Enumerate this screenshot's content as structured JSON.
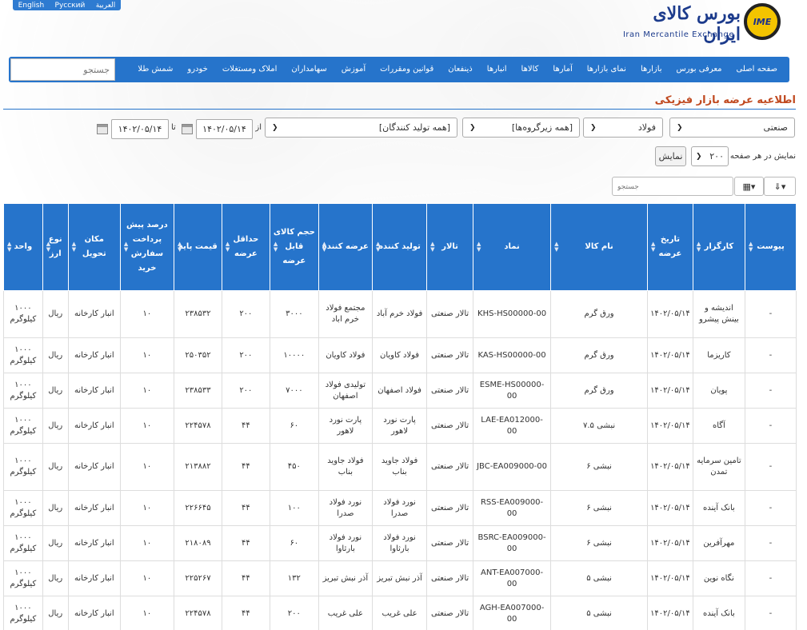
{
  "lang": [
    "العربية",
    "Русский",
    "English"
  ],
  "logo": {
    "mark": "IME",
    "fa": "بورس کالای ایران",
    "en": "Iran Mercantile Exchange"
  },
  "nav": [
    "صفحه اصلی",
    "معرفی بورس",
    "بازارها",
    "نمای بازارها",
    "آمارها",
    "کالاها",
    "انبارها",
    "ذینفعان",
    "قوانین ومقررات",
    "آموزش",
    "سهامداران",
    "املاک ومستغلات",
    "خودرو",
    "شمش طلا"
  ],
  "nav_search_placeholder": "جستجو",
  "page_title": "اطلاعیه عرضه بازار فیزیکی",
  "filters": {
    "market": "صنعتی",
    "group": "فولاد",
    "subgroup": "[همه زیرگروه‌ها]",
    "producer": "[همه تولید کنندگان]",
    "from_label": "از",
    "from_date": "۱۴۰۲/۰۵/۱۴",
    "to_label": "تا",
    "to_date": "۱۴۰۲/۰۵/۱۴",
    "per_page_label": "نمایش در هر صفحه",
    "per_page": "۲۰۰",
    "show_button": "نمایش"
  },
  "table_search_placeholder": "جستجو",
  "headers": [
    "پیوست",
    "کارگزار",
    "تاریخ عرضه",
    "نام کالا",
    "نماد",
    "تالار",
    "تولید کننده",
    "عرضه کننده",
    "حجم کالای قابل عرضه",
    "حداقل عرضه",
    "قیمت پایه",
    "درصد پیش پرداخت سفارش خرید",
    "مکان تحویل",
    "نوع ارز",
    "واحد"
  ],
  "rows": [
    [
      "-",
      "اندیشه و بینش پیشرو",
      "۱۴۰۲/۰۵/۱۴",
      "ورق گرم",
      "KHS-HS00000-00",
      "تالار صنعتی",
      "فولاد خرم آباد",
      "مجتمع فولاد خرم اباد",
      "۳۰۰۰",
      "۲۰۰",
      "۲۳۸۵۳۲",
      "۱۰",
      "انبار کارخانه",
      "ریال",
      "۱۰۰۰ کیلوگرم"
    ],
    [
      "-",
      "کاریزما",
      "۱۴۰۲/۰۵/۱۴",
      "ورق گرم",
      "KAS-HS00000-00",
      "تالار صنعتی",
      "فولاد کاویان",
      "فولاد کاویان",
      "۱۰۰۰۰",
      "۲۰۰",
      "۲۵۰۳۵۲",
      "۱۰",
      "انبار کارخانه",
      "ریال",
      "۱۰۰۰ کیلوگرم"
    ],
    [
      "-",
      "پویان",
      "۱۴۰۲/۰۵/۱۴",
      "ورق گرم",
      "ESME-HS00000-00",
      "تالار صنعتی",
      "فولاد اصفهان",
      "تولیدی فولاد اصفهان",
      "۷۰۰۰",
      "۲۰۰",
      "۲۳۸۵۳۳",
      "۱۰",
      "انبار کارخانه",
      "ریال",
      "۱۰۰۰ کیلوگرم"
    ],
    [
      "-",
      "آگاه",
      "۱۴۰۲/۰۵/۱۴",
      "نبشی ۷.۵",
      "LAE-EA012000-00",
      "تالار صنعتی",
      "پارت نورد لاهور",
      "پارت نورد لاهور",
      "۶۰",
      "۴۴",
      "۲۲۴۵۷۸",
      "۱۰",
      "انبار کارخانه",
      "ریال",
      "۱۰۰۰ کیلوگرم"
    ],
    [
      "-",
      "تامین سرمایه تمدن",
      "۱۴۰۲/۰۵/۱۴",
      "نبشی ۶",
      "JBC-EA009000-00",
      "تالار صنعتی",
      "فولاد جاوید بناب",
      "فولاد جاوید بناب",
      "۴۵۰",
      "۴۴",
      "۲۱۳۸۸۲",
      "۱۰",
      "انبار کارخانه",
      "ریال",
      "۱۰۰۰ کیلوگرم"
    ],
    [
      "-",
      "بانک آینده",
      "۱۴۰۲/۰۵/۱۴",
      "نبشی ۶",
      "RSS-EA009000-00",
      "تالار صنعتی",
      "نورد فولاد صدرا",
      "نورد فولاد صدرا",
      "۱۰۰",
      "۴۴",
      "۲۲۶۶۴۵",
      "۱۰",
      "انبار کارخانه",
      "ریال",
      "۱۰۰۰ کیلوگرم"
    ],
    [
      "-",
      "مهرآفرین",
      "۱۴۰۲/۰۵/۱۴",
      "نبشی ۶",
      "BSRC-EA009000-00",
      "تالار صنعتی",
      "نورد فولاد بارثاوا",
      "نورد فولاد بارثاوا",
      "۶۰",
      "۴۴",
      "۲۱۸۰۸۹",
      "۱۰",
      "انبار کارخانه",
      "ریال",
      "۱۰۰۰ کیلوگرم"
    ],
    [
      "-",
      "نگاه نوین",
      "۱۴۰۲/۰۵/۱۴",
      "نبشی ۵",
      "ANT-EA007000-00",
      "تالار صنعتی",
      "آذر نبش تبریز",
      "آذر نبش تبریز",
      "۱۳۲",
      "۴۴",
      "۲۲۵۲۶۷",
      "۱۰",
      "انبار کارخانه",
      "ریال",
      "۱۰۰۰ کیلوگرم"
    ],
    [
      "-",
      "بانک آینده",
      "۱۴۰۲/۰۵/۱۴",
      "نبشی ۵",
      "AGH-EA007000-00",
      "تالار صنعتی",
      "علی غریب",
      "علی غریب",
      "۲۰۰",
      "۴۴",
      "۲۲۴۵۷۸",
      "۱۰",
      "انبار کارخانه",
      "ریال",
      "۱۰۰۰ کیلوگرم"
    ]
  ]
}
